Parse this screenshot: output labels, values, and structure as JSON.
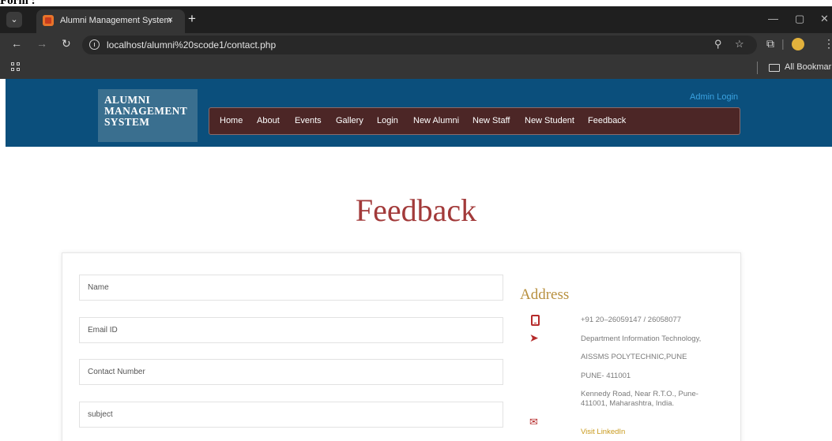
{
  "document": {
    "heading": "Form :"
  },
  "browser": {
    "tab_title": "Alumni Management System",
    "tab_close": "×",
    "new_tab": "+",
    "url": "localhost/alumni%20scode1/contact.php",
    "bookmarks_label": "All Bookmarks",
    "icons": [
      "tab-search-icon",
      "back-arrow-icon",
      "forward-arrow-icon",
      "reload-icon",
      "site-info-icon",
      "zoom-icon",
      "star-icon",
      "extensions-icon",
      "profile-icon",
      "menu-icon",
      "apps-grid-icon",
      "folder-icon",
      "minimize-icon",
      "restore-icon",
      "close-icon"
    ]
  },
  "header": {
    "logo_lines": [
      "ALUMNI",
      "MANAGEMENT",
      "SYSTEM"
    ],
    "admin_login": "Admin Login",
    "nav": [
      "Home",
      "About",
      "Events",
      "Gallery",
      "Login",
      "New Alumni",
      "New Staff",
      "New Student",
      "Feedback"
    ]
  },
  "main": {
    "title": "Feedback",
    "form": {
      "name_placeholder": "Name",
      "email_placeholder": "Email ID",
      "contact_placeholder": "Contact Number",
      "subject_placeholder": "subject"
    },
    "address": {
      "title": "Address",
      "phone": "+91 20–26059147 / 26058077",
      "department": "Department Information Technology,",
      "college": "AISSMS POLYTECHNIC,PUNE",
      "city": "PUNE- 411001",
      "street_line1": "Kennedy Road, Near R.T.O., Pune-",
      "street_line2": "411001, Maharashtra, India.",
      "linkedin": "Visit LinkedIn"
    }
  },
  "colors": {
    "header_bg": "#0b4f7c",
    "nav_bg": "#4c2626",
    "title": "#a23a3a",
    "address_title": "#b8903f",
    "icon_red": "#b52b2b",
    "link": "#c99a1d"
  }
}
